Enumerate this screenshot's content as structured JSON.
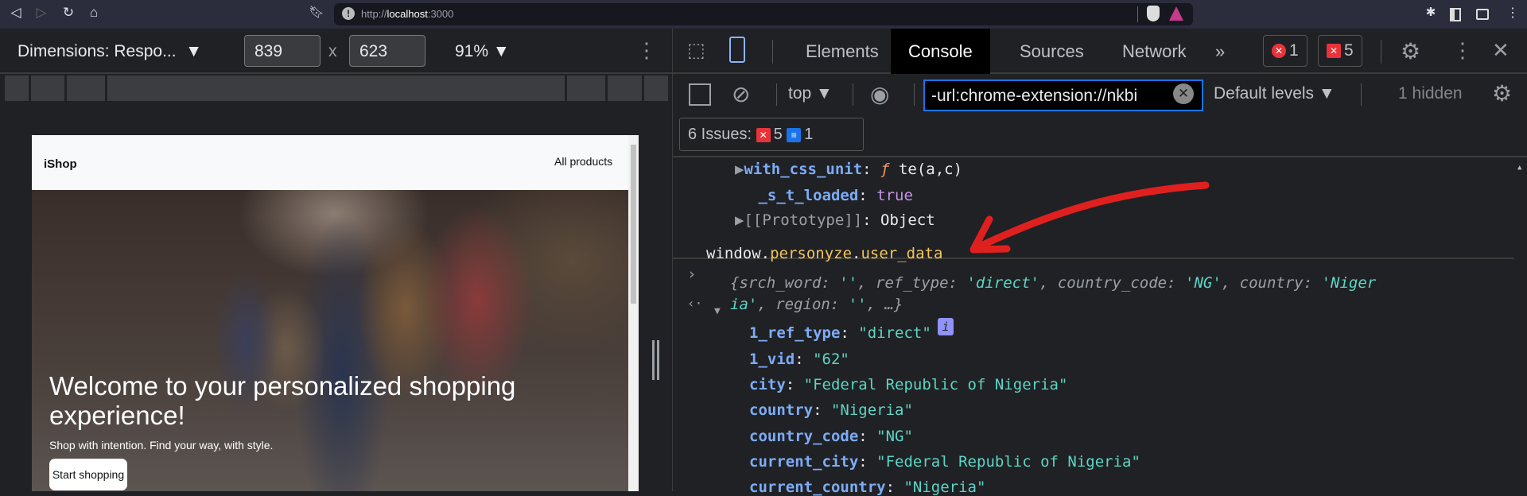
{
  "browser": {
    "url_scheme": "http://",
    "url_host": "localhost",
    "url_port": ":3000"
  },
  "device_toolbar": {
    "dimensions_label": "Dimensions: Respo...",
    "width": "839",
    "height": "623",
    "times": "x",
    "zoom": "91%"
  },
  "webpage": {
    "brand": "iShop",
    "nav_link": "All products",
    "headline": "Welcome to your personalized shopping experience!",
    "subtitle": "Shop with intention. Find your way, with style.",
    "cta": "Start shopping"
  },
  "devtools": {
    "tabs": [
      {
        "label": "Elements"
      },
      {
        "label": "Console",
        "active": true
      },
      {
        "label": "Sources"
      },
      {
        "label": "Network"
      }
    ],
    "more": "»",
    "error_count": "1",
    "issue_count": "5",
    "context": "top",
    "filter": "-url:chrome-extension://nkbi",
    "levels": "Default levels",
    "hidden": "1 hidden",
    "issues": {
      "label": "6 Issues:",
      "errors": "5",
      "info": "1"
    }
  },
  "console_lines": [
    [
      {
        "t": "▶",
        "c": "kp"
      },
      {
        "t": "with_css_unit",
        "c": "k"
      },
      {
        "t": ": ",
        "c": "w"
      },
      {
        "t": "ƒ ",
        "c": "o"
      },
      {
        "t": "te(a,c)",
        "c": "w"
      }
    ],
    [
      {
        "t": " _s_t_loaded",
        "c": "k"
      },
      {
        "t": ": ",
        "c": "w"
      },
      {
        "t": "true",
        "c": "b"
      }
    ],
    [
      {
        "t": "▶",
        "c": "kp"
      },
      {
        "t": "[[Prototype]]",
        "c": "kp"
      },
      {
        "t": ": Object",
        "c": "w"
      }
    ],
    [
      {
        "t": "window.",
        "c": "w"
      },
      {
        "t": "personyze",
        "c": "y"
      },
      {
        "t": ".",
        "c": "w"
      },
      {
        "t": "user_data",
        "c": "y"
      }
    ],
    [
      {
        "t": "{srch_word: ",
        "c": "ki"
      },
      {
        "t": "''",
        "c": "si"
      },
      {
        "t": ", ref_type: ",
        "c": "ki"
      },
      {
        "t": "'direct'",
        "c": "si"
      },
      {
        "t": ", country_code: ",
        "c": "ki"
      },
      {
        "t": "'NG'",
        "c": "si"
      },
      {
        "t": ", country: ",
        "c": "ki"
      },
      {
        "t": "'Niger",
        "c": "si"
      }
    ],
    [
      {
        "t": "ia'",
        "c": "si"
      },
      {
        "t": ", region: ",
        "c": "ki"
      },
      {
        "t": "''",
        "c": "si"
      },
      {
        "t": ", …}",
        "c": "ki"
      }
    ],
    [
      {
        "t": "1_ref_type",
        "c": "k"
      },
      {
        "t": ": ",
        "c": "w"
      },
      {
        "t": "\"direct\"",
        "c": "s"
      }
    ],
    [
      {
        "t": "1_vid",
        "c": "k"
      },
      {
        "t": ": ",
        "c": "w"
      },
      {
        "t": "\"62\"",
        "c": "s"
      }
    ],
    [
      {
        "t": "city",
        "c": "k"
      },
      {
        "t": ": ",
        "c": "w"
      },
      {
        "t": "\"Federal Republic of Nigeria\"",
        "c": "s"
      }
    ],
    [
      {
        "t": "country",
        "c": "k"
      },
      {
        "t": ": ",
        "c": "w"
      },
      {
        "t": "\"Nigeria\"",
        "c": "s"
      }
    ],
    [
      {
        "t": "country_code",
        "c": "k"
      },
      {
        "t": ": ",
        "c": "w"
      },
      {
        "t": "\"NG\"",
        "c": "s"
      }
    ],
    [
      {
        "t": "current_city",
        "c": "k"
      },
      {
        "t": ": ",
        "c": "w"
      },
      {
        "t": "\"Federal Republic of Nigeria\"",
        "c": "s"
      }
    ],
    [
      {
        "t": "current_country",
        "c": "k"
      },
      {
        "t": ": ",
        "c": "w"
      },
      {
        "t": "\"Nigeria\"",
        "c": "s"
      }
    ]
  ],
  "annotation_color": "#e0201e"
}
